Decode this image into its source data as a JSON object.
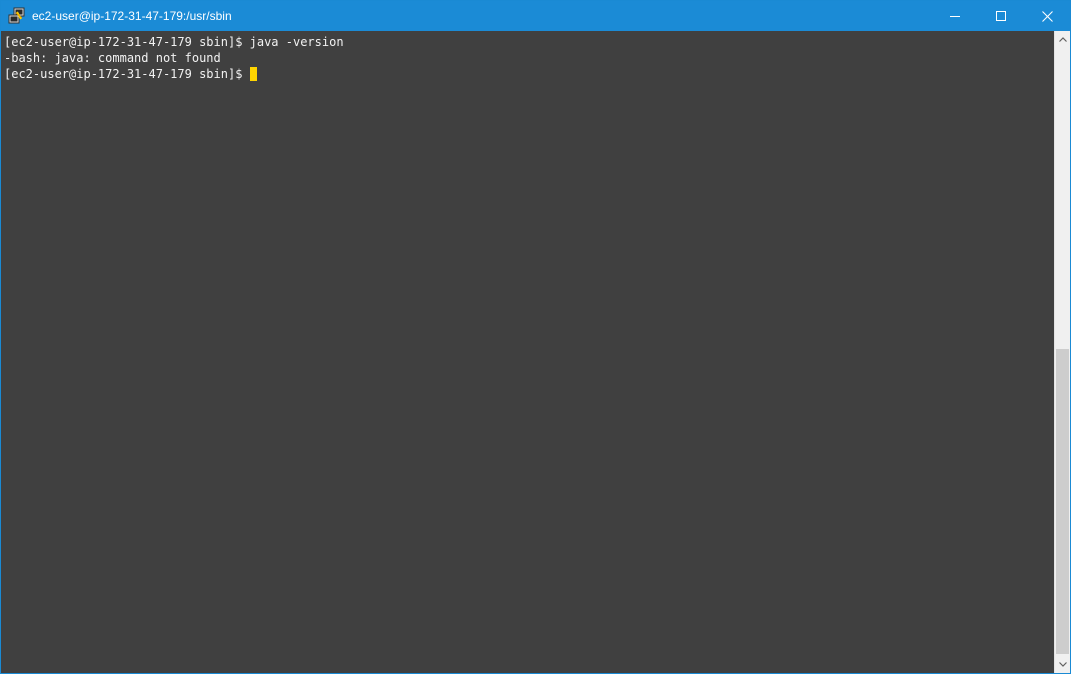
{
  "window": {
    "title": "ec2-user@ip-172-31-47-179:/usr/sbin",
    "accent_color": "#1b8bd6",
    "icon": "putty-icon"
  },
  "caption_buttons": {
    "minimize_icon": "minimize-icon",
    "maximize_icon": "maximize-icon",
    "close_icon": "close-icon"
  },
  "terminal": {
    "background": "#404040",
    "text_color": "#f2f2f2",
    "cursor_color": "#ffd500",
    "lines": [
      "[ec2-user@ip-172-31-47-179 sbin]$ java -version",
      "-bash: java: command not found",
      "[ec2-user@ip-172-31-47-179 sbin]$ "
    ]
  },
  "scrollbar": {
    "up_icon": "scroll-up-arrow-icon",
    "down_icon": "scroll-down-arrow-icon"
  }
}
